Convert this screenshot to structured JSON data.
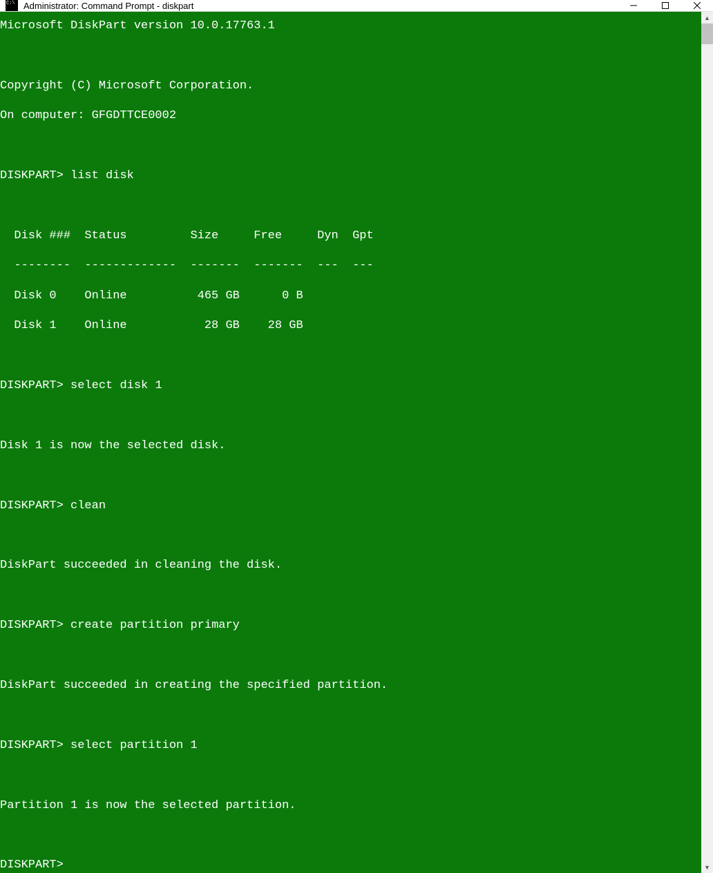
{
  "window": {
    "title": "Administrator: Command Prompt - diskpart"
  },
  "console": {
    "version_line": "Microsoft DiskPart version 10.0.17763.1",
    "copyright_line": "Copyright (C) Microsoft Corporation.",
    "computer_line": "On computer: GFGDTTCE0002",
    "prompt": "DISKPART>",
    "commands": {
      "list_disk": "list disk",
      "select_disk": "select disk 1",
      "clean": "clean",
      "create_partition": "create partition primary",
      "select_partition": "select partition 1"
    },
    "table": {
      "header": "  Disk ###  Status         Size     Free     Dyn  Gpt",
      "divider": "  --------  -------------  -------  -------  ---  ---",
      "rows": [
        "  Disk 0    Online          465 GB      0 B",
        "  Disk 1    Online           28 GB    28 GB"
      ]
    },
    "responses": {
      "disk_selected": "Disk 1 is now the selected disk.",
      "clean_ok": "DiskPart succeeded in cleaning the disk.",
      "create_ok": "DiskPart succeeded in creating the specified partition.",
      "partition_selected": "Partition 1 is now the selected partition."
    }
  }
}
